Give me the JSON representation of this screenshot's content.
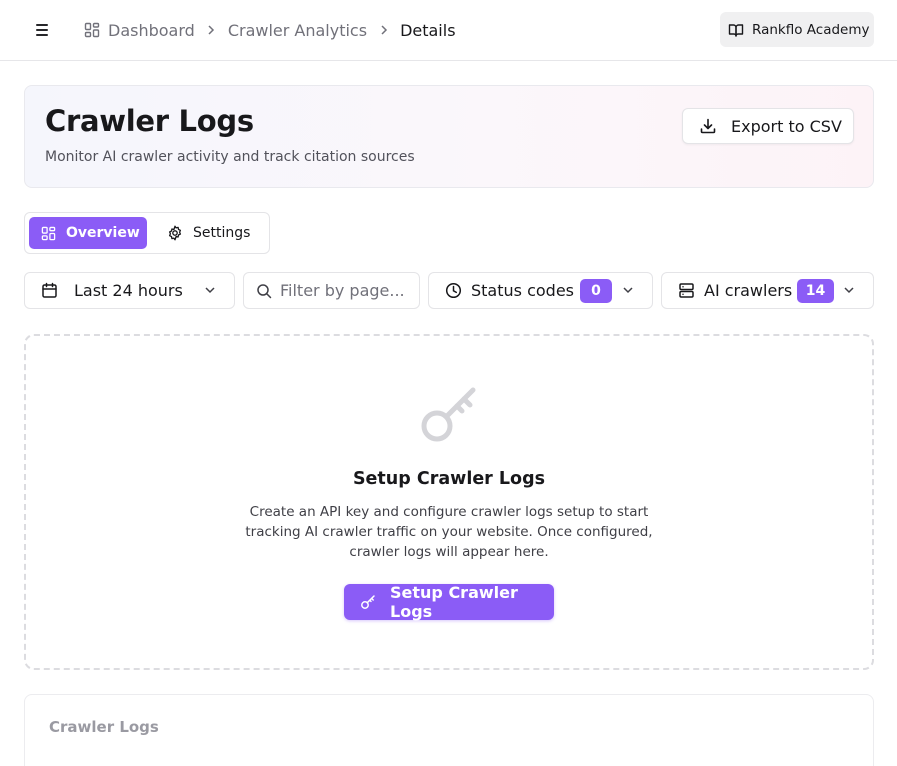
{
  "topbar": {
    "menu_icon": "menu-icon",
    "breadcrumb": [
      {
        "label": "Dashboard",
        "icon": "dashboard-grid-icon"
      },
      {
        "label": "Crawler Analytics"
      },
      {
        "label": "Details"
      }
    ],
    "academy_label": "Rankflo Academy",
    "academy_icon": "book-open-icon"
  },
  "header": {
    "title": "Crawler Logs",
    "subtitle": "Monitor AI crawler activity and track citation sources",
    "export_label": "Export to CSV",
    "export_icon": "download-icon"
  },
  "tabs": [
    {
      "label": "Overview",
      "icon": "dashboard-grid-icon",
      "active": true
    },
    {
      "label": "Settings",
      "icon": "gear-icon",
      "active": false
    }
  ],
  "filters": {
    "date_range": {
      "value": "Last 24 hours",
      "icon": "calendar-icon"
    },
    "search": {
      "placeholder": "Filter by page...",
      "value": "",
      "icon": "search-icon"
    },
    "status_codes": {
      "label": "Status codes",
      "count": "0",
      "icon": "clock-icon"
    },
    "ai_crawlers": {
      "label": "AI crawlers",
      "count": "14",
      "icon": "server-icon"
    }
  },
  "empty_state": {
    "icon": "key-icon",
    "title": "Setup Crawler Logs",
    "description": "Create an API key and configure crawler logs setup to start tracking AI crawler traffic on your website. Once configured, crawler logs will appear here.",
    "button_label": "Setup Crawler Logs",
    "button_icon": "key-icon"
  },
  "logs_section": {
    "title": "Crawler Logs"
  },
  "colors": {
    "accent": "#8b5cf6",
    "text": "#18181b",
    "muted": "#71717a",
    "border": "#e4e4e7"
  }
}
